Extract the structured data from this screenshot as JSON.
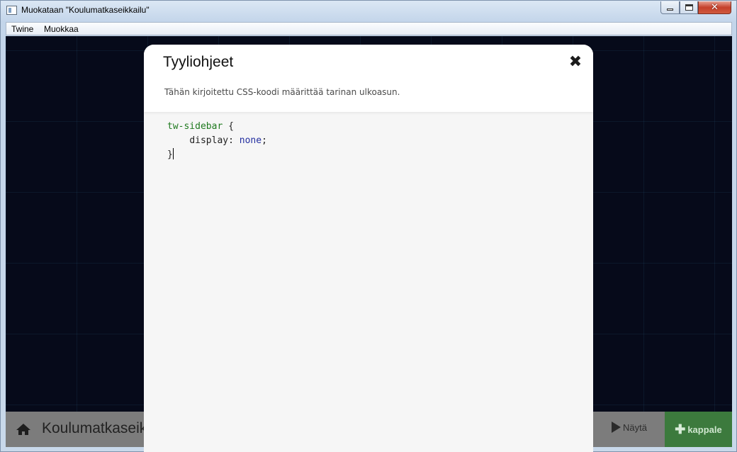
{
  "window": {
    "title": "Muokataan \"Koulumatkaseikkailu\"",
    "close_glyph": "✕"
  },
  "menubar": {
    "items": [
      "Twine",
      "Muokkaa"
    ]
  },
  "bottom_bar": {
    "story_name": "Koulumatkaseikkailu",
    "hidden_text": "..",
    "play_label": "Näytä",
    "add_label": "kappale",
    "add_icon": "plus-icon",
    "home_icon": "home-icon"
  },
  "dialog": {
    "title": "Tyyliohjeet",
    "description": "Tähän kirjoitettu CSS-koodi määrittää tarinan ulkoasun.",
    "close_glyph": "✖",
    "code": {
      "line1_selector": "tw-sidebar",
      "line1_brace": " {",
      "line2_indent": "    ",
      "line2_property": "display",
      "line2_colon": ": ",
      "line2_value": "none",
      "line2_semicolon": ";",
      "line3_brace": "}"
    }
  },
  "colors": {
    "canvas_bg": "#060a1a",
    "add_button_bg": "#3c7a3d",
    "css_selector": "#1f7a1f",
    "css_value": "#232ea0"
  }
}
